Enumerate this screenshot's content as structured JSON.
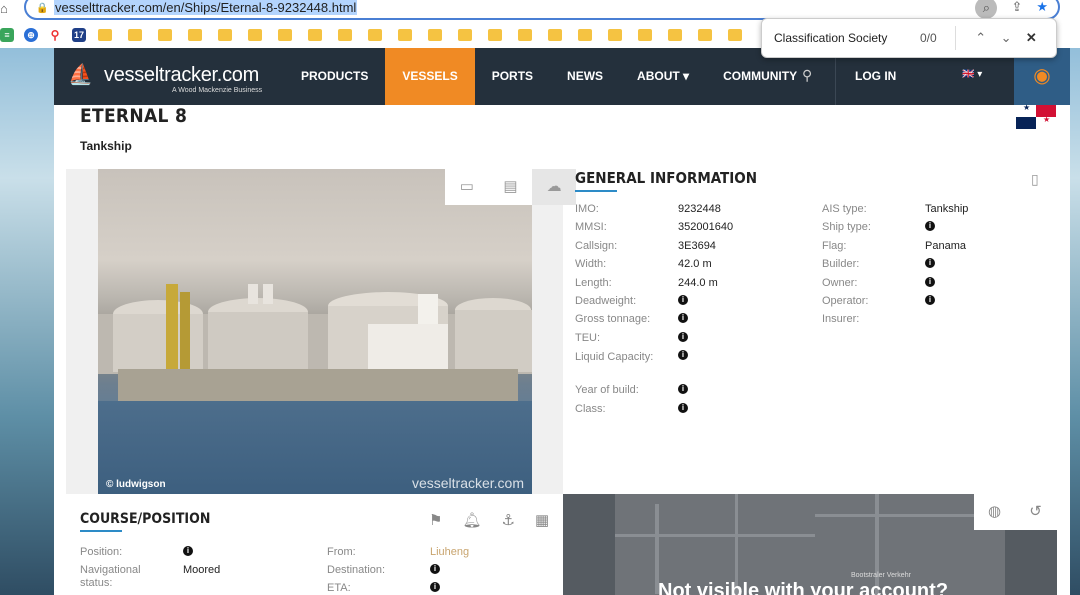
{
  "browser": {
    "url": "vesselttracker.com/en/Ships/Eternal-8-9232448.html",
    "find": {
      "query": "Classification Society",
      "count": "0/0"
    }
  },
  "nav": {
    "logo_name": "vesseltracker.com",
    "logo_tagline": "A Wood Mackenzie Business",
    "items": [
      "PRODUCTS",
      "VESSELS",
      "PORTS",
      "NEWS",
      "ABOUT ▾",
      "COMMUNITY"
    ],
    "login": "LOG IN"
  },
  "ship": {
    "name": "ETERNAL 8",
    "type": "Tankship"
  },
  "photo": {
    "credit": "© ludwigson",
    "watermark": "vesseltracker.com"
  },
  "general": {
    "title": "GENERAL INFORMATION",
    "left": [
      {
        "k": "IMO:",
        "v": "9232448"
      },
      {
        "k": "MMSI:",
        "v": "352001640"
      },
      {
        "k": "Callsign:",
        "v": "3E3694"
      },
      {
        "k": "Width:",
        "v": "42.0 m"
      },
      {
        "k": "Length:",
        "v": "244.0 m"
      },
      {
        "k": "Deadweight:",
        "v": ""
      },
      {
        "k": "Gross tonnage:",
        "v": ""
      },
      {
        "k": "TEU:",
        "v": ""
      },
      {
        "k": "Liquid Capacity:",
        "v": ""
      },
      {
        "k": "Year of build:",
        "v": ""
      },
      {
        "k": "Class:",
        "v": ""
      }
    ],
    "right": [
      {
        "k": "AIS type:",
        "v": "Tankship"
      },
      {
        "k": "Ship type:",
        "v": ""
      },
      {
        "k": "Flag:",
        "v": "Panama"
      },
      {
        "k": "Builder:",
        "v": ""
      },
      {
        "k": "Owner:",
        "v": ""
      },
      {
        "k": "Operator:",
        "v": ""
      },
      {
        "k": "Insurer:",
        "v": "-"
      }
    ]
  },
  "course": {
    "title": "COURSE/POSITION",
    "left": [
      {
        "k": "Position:",
        "v": ""
      },
      {
        "k": "Navigational status:",
        "v": "Moored"
      }
    ],
    "right": [
      {
        "k": "From:",
        "v": "Liuheng"
      },
      {
        "k": "Destination:",
        "v": ""
      },
      {
        "k": "ETA:",
        "v": ""
      }
    ]
  },
  "map": {
    "message": "Not visible with your account?",
    "label": "Bootstraler Verkehr"
  },
  "colors": {
    "nav_bg": "#24303c",
    "active": "#f08a24",
    "accent": "#2d8bc7"
  }
}
